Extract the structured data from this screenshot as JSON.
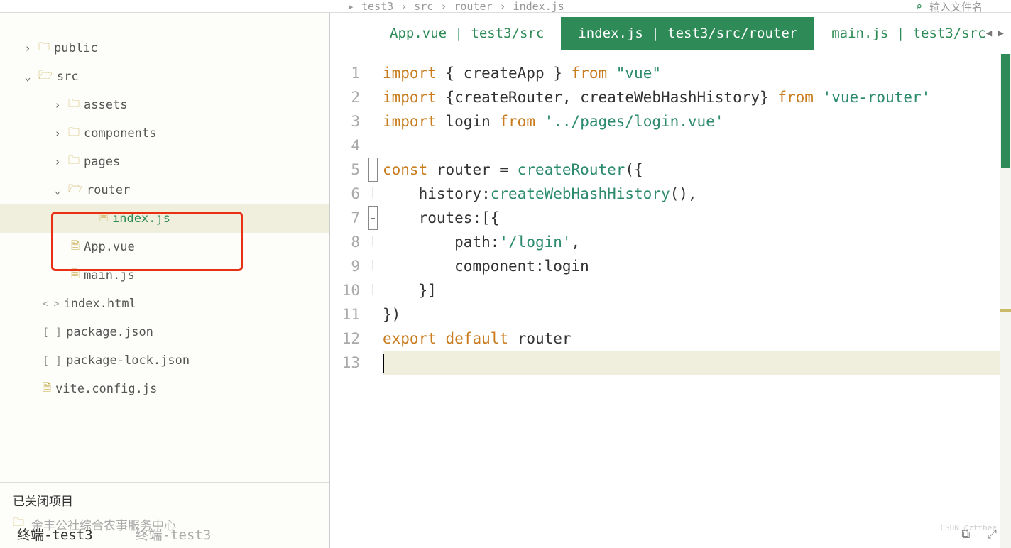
{
  "breadcrumb": [
    "test3",
    "src",
    "router",
    "index.js"
  ],
  "search_placeholder": "输入文件名",
  "sidebar": {
    "tree": [
      {
        "type": "folder",
        "name": "public",
        "depth": 1,
        "expanded": false
      },
      {
        "type": "folder",
        "name": "src",
        "depth": 1,
        "expanded": true
      },
      {
        "type": "folder",
        "name": "assets",
        "depth": 2,
        "expanded": false
      },
      {
        "type": "folder",
        "name": "components",
        "depth": 2,
        "expanded": false
      },
      {
        "type": "folder",
        "name": "pages",
        "depth": 2,
        "expanded": false
      },
      {
        "type": "folder",
        "name": "router",
        "depth": 2,
        "expanded": true,
        "highlight": true
      },
      {
        "type": "file-js",
        "name": "index.js",
        "depth": 3,
        "selected": true,
        "active": true
      },
      {
        "type": "file-vue",
        "name": "App.vue",
        "depth": 2
      },
      {
        "type": "file-js",
        "name": "main.js",
        "depth": 2
      },
      {
        "type": "file-html",
        "name": "index.html",
        "depth": 1
      },
      {
        "type": "file-json",
        "name": "package.json",
        "depth": 1
      },
      {
        "type": "file-json",
        "name": "package-lock.json",
        "depth": 1
      },
      {
        "type": "file-js",
        "name": "vite.config.js",
        "depth": 1
      }
    ],
    "closed_label": "已关闭项目",
    "closed_project": "金丰公社综合农事服务中心"
  },
  "tabs": [
    {
      "label": "App.vue | test3/src",
      "active": false
    },
    {
      "label": "index.js | test3/src/router",
      "active": true
    },
    {
      "label": "main.js | test3/src",
      "active": false
    }
  ],
  "code": {
    "lines": [
      {
        "n": 1,
        "tokens": [
          [
            "kw",
            "import"
          ],
          [
            "punc",
            " { "
          ],
          [
            "id",
            "createApp"
          ],
          [
            "punc",
            " } "
          ],
          [
            "kw",
            "from"
          ],
          [
            "punc",
            " "
          ],
          [
            "str",
            "\"vue\""
          ]
        ]
      },
      {
        "n": 2,
        "tokens": [
          [
            "kw",
            "import"
          ],
          [
            "punc",
            " {"
          ],
          [
            "id",
            "createRouter"
          ],
          [
            "punc",
            ", "
          ],
          [
            "id",
            "createWebHashHistory"
          ],
          [
            "punc",
            "} "
          ],
          [
            "kw",
            "from"
          ],
          [
            "punc",
            " "
          ],
          [
            "str",
            "'vue-router'"
          ]
        ]
      },
      {
        "n": 3,
        "tokens": [
          [
            "kw",
            "import"
          ],
          [
            "punc",
            " "
          ],
          [
            "id",
            "login"
          ],
          [
            "punc",
            " "
          ],
          [
            "kw",
            "from"
          ],
          [
            "punc",
            " "
          ],
          [
            "str",
            "'../pages/login.vue'"
          ]
        ]
      },
      {
        "n": 4,
        "tokens": []
      },
      {
        "n": 5,
        "fold": "-",
        "tokens": [
          [
            "kw",
            "const"
          ],
          [
            "punc",
            " "
          ],
          [
            "id",
            "router"
          ],
          [
            "punc",
            " = "
          ],
          [
            "fn",
            "createRouter"
          ],
          [
            "punc",
            "({"
          ]
        ]
      },
      {
        "n": 6,
        "guide": 1,
        "tokens": [
          [
            "punc",
            "    "
          ],
          [
            "id",
            "history"
          ],
          [
            "punc",
            ":"
          ],
          [
            "fn",
            "createWebHashHistory"
          ],
          [
            "punc",
            "(),"
          ]
        ]
      },
      {
        "n": 7,
        "fold": "-",
        "guide": 1,
        "tokens": [
          [
            "punc",
            "    "
          ],
          [
            "id",
            "routes"
          ],
          [
            "punc",
            ":[{"
          ]
        ]
      },
      {
        "n": 8,
        "guide": 2,
        "tokens": [
          [
            "punc",
            "        "
          ],
          [
            "id",
            "path"
          ],
          [
            "punc",
            ":"
          ],
          [
            "str",
            "'/login'"
          ],
          [
            "punc",
            ","
          ]
        ]
      },
      {
        "n": 9,
        "guide": 2,
        "tokens": [
          [
            "punc",
            "        "
          ],
          [
            "id",
            "component"
          ],
          [
            "punc",
            ":"
          ],
          [
            "id",
            "login"
          ]
        ]
      },
      {
        "n": 10,
        "guide": 1,
        "tokens": [
          [
            "punc",
            "    }]"
          ]
        ]
      },
      {
        "n": 11,
        "tokens": [
          [
            "punc",
            "})"
          ]
        ]
      },
      {
        "n": 12,
        "tokens": [
          [
            "kw",
            "export"
          ],
          [
            "punc",
            " "
          ],
          [
            "kw",
            "default"
          ],
          [
            "punc",
            " "
          ],
          [
            "id",
            "router"
          ]
        ]
      },
      {
        "n": 13,
        "cursor": true,
        "tokens": []
      }
    ]
  },
  "terminal": {
    "tab1": "终端-test3",
    "tab2": "终端-test3"
  },
  "watermark": "CSDN @ztthee"
}
